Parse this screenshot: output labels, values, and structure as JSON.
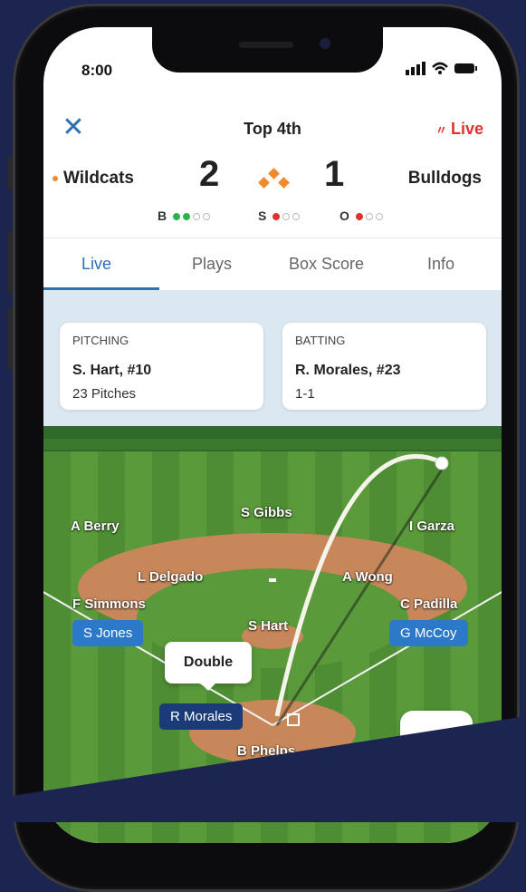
{
  "status_bar": {
    "time": "8:00"
  },
  "header": {
    "close_icon": "close-icon",
    "inning": "Top 4th",
    "live_label": "Live",
    "live_color": "#e0322f"
  },
  "scoreboard": {
    "home_team": "Wildcats",
    "home_score": "2",
    "away_score": "1",
    "away_team": "Bulldogs",
    "possession_color": "#f08a2c",
    "count": {
      "balls_label": "B",
      "balls": 2,
      "strikes_label": "S",
      "strikes": 1,
      "outs_label": "O",
      "outs": 1
    }
  },
  "tabs": [
    {
      "label": "Live",
      "active": true
    },
    {
      "label": "Plays",
      "active": false
    },
    {
      "label": "Box Score",
      "active": false
    },
    {
      "label": "Info",
      "active": false
    }
  ],
  "pitching": {
    "header": "PITCHING",
    "name": "S. Hart, #10",
    "stat": "23 Pitches"
  },
  "batting": {
    "header": "BATTING",
    "name": "R. Morales, #23",
    "stat": "1-1"
  },
  "fielders": {
    "f1": "A Berry",
    "f2": "S Gibbs",
    "f3": "I Garza",
    "f4": "L Delgado",
    "f5": "A Wong",
    "f6": "F Simmons",
    "f7": "C Padilla",
    "f8": "S Hart",
    "f9": "B Phelps"
  },
  "runners": {
    "r1": "S Jones",
    "r2": "G McCoy",
    "batter": "R Morales"
  },
  "play_result": "Double",
  "sound_icon": "speaker-icon",
  "accent_color": "#2a6fb8"
}
